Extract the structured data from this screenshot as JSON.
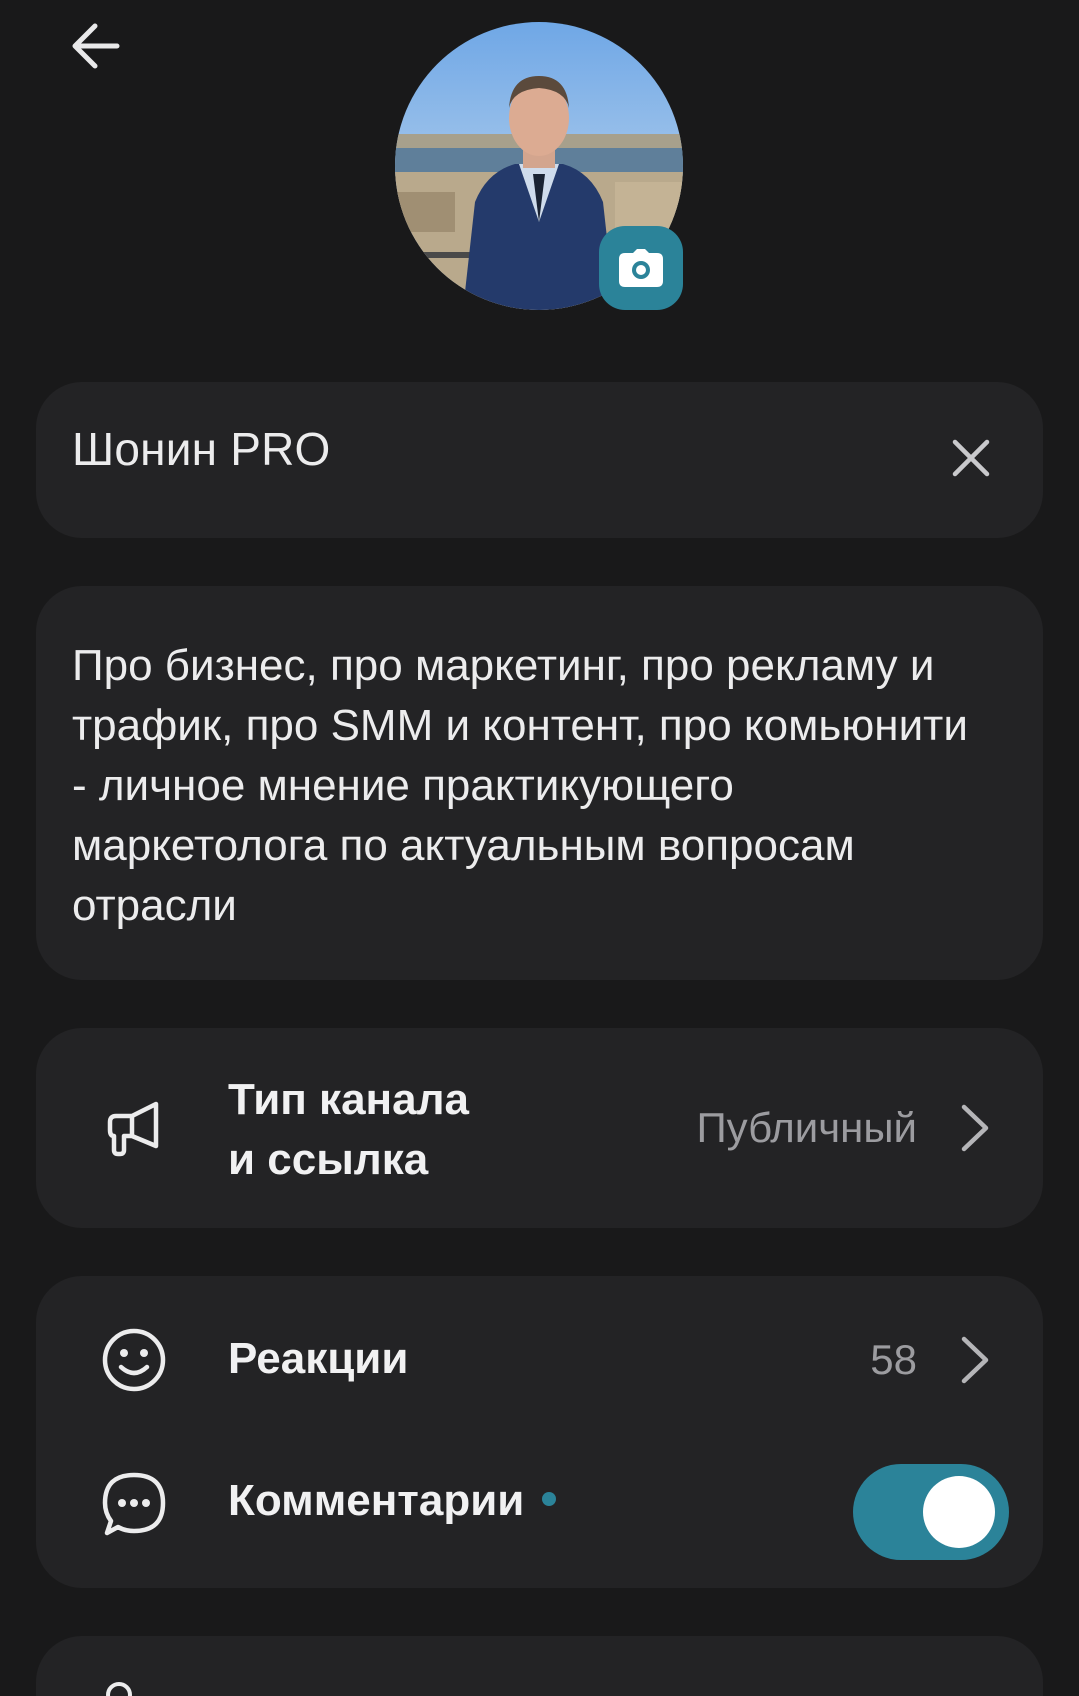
{
  "header": {
    "back_icon": "arrow-left-icon"
  },
  "avatar": {
    "camera_icon": "camera-icon",
    "accent": "#2b8399"
  },
  "name_field": {
    "value": "Шонин PRO",
    "clear_icon": "close-icon"
  },
  "description": {
    "value": "Про бизнес, про маркетинг, про рекламу и трафик, про SMM и контент, про комьюнити - личное мнение практикующего маркетолога по актуальным вопросам отрасли"
  },
  "channel_type": {
    "title_line1": "Тип канала",
    "title_line2": "и ссылка",
    "value": "Публичный",
    "icon": "megaphone-icon"
  },
  "reactions": {
    "title": "Реакции",
    "count": "58",
    "icon": "smile-icon"
  },
  "comments": {
    "title": "Комментарии",
    "icon": "chat-bubble-icon",
    "enabled": true
  },
  "colors": {
    "background": "#19191a",
    "card": "#232325",
    "accent": "#2b8399"
  }
}
